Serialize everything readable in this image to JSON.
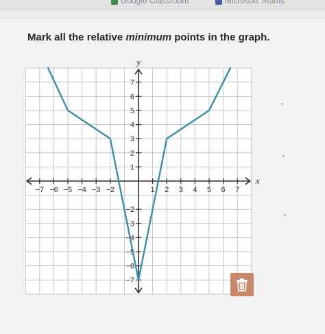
{
  "bookmarks": [
    {
      "label": "Google Classroom",
      "icon": "google-classroom-icon",
      "color": "#3d8b4d"
    },
    {
      "label": "Microsoft Teams",
      "icon": "teams-icon",
      "color": "#5058a8"
    }
  ],
  "question": {
    "prefix": "Mark all the relative ",
    "emphasis": "minimum",
    "suffix": " points in the graph."
  },
  "chart_data": {
    "type": "line",
    "xlabel": "x",
    "ylabel": "y",
    "xlim": [
      -8,
      8
    ],
    "ylim": [
      -8,
      8
    ],
    "grid": true,
    "x_tick_labels": [
      "−7",
      "−6",
      "−5",
      "−4",
      "−3",
      "−2",
      "1",
      "2",
      "3",
      "4",
      "5",
      "6",
      "7"
    ],
    "x_tick_values": [
      -7,
      -6,
      -5,
      -4,
      -3,
      -2,
      1,
      2,
      3,
      4,
      5,
      6,
      7
    ],
    "y_tick_labels": [
      "7",
      "6",
      "5",
      "4",
      "3",
      "2",
      "1",
      "−2",
      "−3",
      "−4",
      "−5",
      "−6",
      "−7"
    ],
    "y_tick_values": [
      7,
      6,
      5,
      4,
      3,
      2,
      1,
      -2,
      -3,
      -4,
      -5,
      -6,
      -7
    ],
    "series": [
      {
        "color": "#3a8fa8",
        "x": [
          -6.4,
          -5,
          -2,
          0,
          2,
          5,
          6.5
        ],
        "y": [
          8,
          5,
          3,
          -7,
          3,
          5,
          8
        ]
      }
    ]
  },
  "trash": {
    "icon": "trash-icon",
    "color": "#c9886a"
  }
}
